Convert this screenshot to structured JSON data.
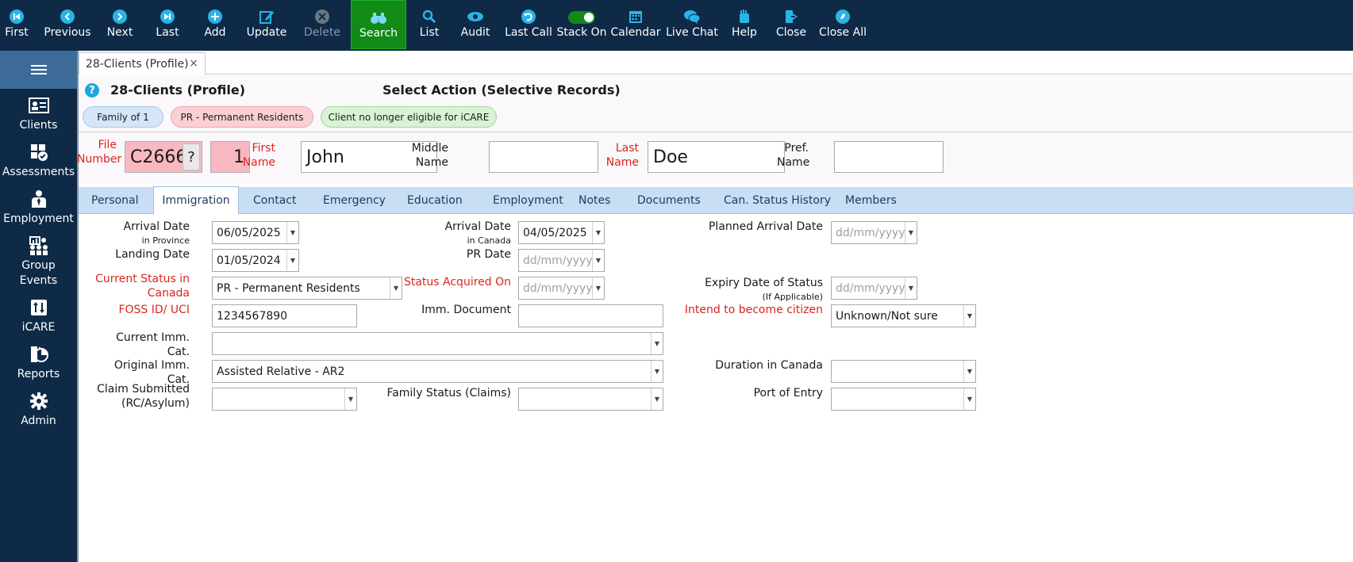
{
  "toolbar": {
    "first": "First",
    "previous": "Previous",
    "next": "Next",
    "last": "Last",
    "add": "Add",
    "update": "Update",
    "delete": "Delete",
    "search": "Search",
    "list": "List",
    "audit": "Audit",
    "last_call": "Last Call",
    "stack_on": "Stack On",
    "calendar": "Calendar",
    "live_chat": "Live Chat",
    "help": "Help",
    "close": "Close",
    "close_all": "Close All"
  },
  "sidebar": {
    "clients": "Clients",
    "assessments": "Assessments",
    "employment": "Employment",
    "group_events_1": "Group",
    "group_events_2": "Events",
    "icare": "iCARE",
    "reports": "Reports",
    "admin": "Admin"
  },
  "doc_tab": {
    "label": "28-Clients (Profile)",
    "close": "×"
  },
  "header": {
    "help": "?",
    "title": "28-Clients (Profile)",
    "action_title": "Select Action (Selective Records)",
    "pills": [
      "Family of 1",
      "PR - Permanent Residents",
      "Client no longer eligible for iCARE"
    ]
  },
  "identity": {
    "file_number_label_1": "File",
    "file_number_label_2": "Number",
    "file_code": "C2666",
    "file_q": "?",
    "file_num": "1",
    "first_name_label_1": "First",
    "first_name_label_2": "Name",
    "first_name": "John",
    "middle_name_label_1": "Middle",
    "middle_name_label_2": "Name",
    "middle_name": "",
    "last_name_label_1": "Last",
    "last_name_label_2": "Name",
    "last_name": "Doe",
    "pref_name_label_1": "Pref.",
    "pref_name_label_2": "Name",
    "pref_name": ""
  },
  "tabs": [
    "Personal",
    "Immigration",
    "Contact",
    "Emergency",
    "Education",
    "Employment",
    "Notes",
    "Documents",
    "Can. Status History",
    "Members"
  ],
  "form": {
    "arrival_province_label": "Arrival Date",
    "arrival_province_sub": "in Province",
    "arrival_province": "06/05/2025",
    "landing_label": "Landing Date",
    "landing": "01/05/2024",
    "current_status_label_1": "Current Status in",
    "current_status_label_2": "Canada",
    "current_status": "PR - Permanent Residents",
    "foss_label": "FOSS ID/ UCI",
    "foss": "1234567890",
    "current_imm_label": "Current Imm. Cat.",
    "current_imm": "",
    "original_imm_label": "Original Imm. Cat.",
    "original_imm": "Assisted Relative - AR2",
    "claim_label_1": "Claim Submitted",
    "claim_label_2": "(RC/Asylum)",
    "claim": "",
    "arrival_canada_label": "Arrival Date",
    "arrival_canada_sub": "in Canada",
    "arrival_canada": "04/05/2025",
    "pr_date_label": "PR Date",
    "pr_date_ph": "dd/mm/yyyy",
    "status_acquired_label": "Status Acquired On",
    "status_acquired_ph": "dd/mm/yyyy",
    "imm_doc_label": "Imm. Document",
    "imm_doc": "",
    "family_status_label": "Family Status (Claims)",
    "family_status": "",
    "planned_arrival_label": "Planned Arrival Date",
    "planned_arrival_ph": "dd/mm/yyyy",
    "expiry_label": "Expiry Date of Status",
    "expiry_sub": "(If Applicable)",
    "expiry_ph": "dd/mm/yyyy",
    "citizen_label": "Intend to become citizen",
    "citizen": "Unknown/Not sure",
    "duration_label": "Duration in Canada",
    "duration": "",
    "port_label": "Port of Entry",
    "port": ""
  },
  "colors": {
    "navy": "#0e2a47",
    "active_green": "#118a18",
    "required_red": "#d9261c",
    "tab_blue": "#c8def4",
    "icon_cyan": "#1ba7e0"
  }
}
